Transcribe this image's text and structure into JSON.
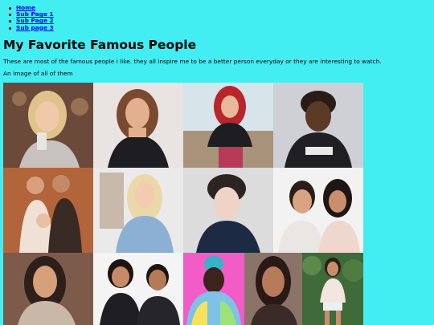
{
  "nav": {
    "items": [
      {
        "label": "Home"
      },
      {
        "label": "Sub Page 1"
      },
      {
        "label": "Sub Page 2"
      },
      {
        "label": "Sub page 3"
      }
    ]
  },
  "page": {
    "title": "My Favorite Famous People",
    "intro": "These are most of the famous people i like. they all inspire me to be a better person everyday or they are interesting to watch.",
    "image_caption": "An image of all of them"
  },
  "collage": {
    "image_name": "famous-people-collage"
  },
  "colors": {
    "background": "#43eef3",
    "link": "#0000ee"
  }
}
